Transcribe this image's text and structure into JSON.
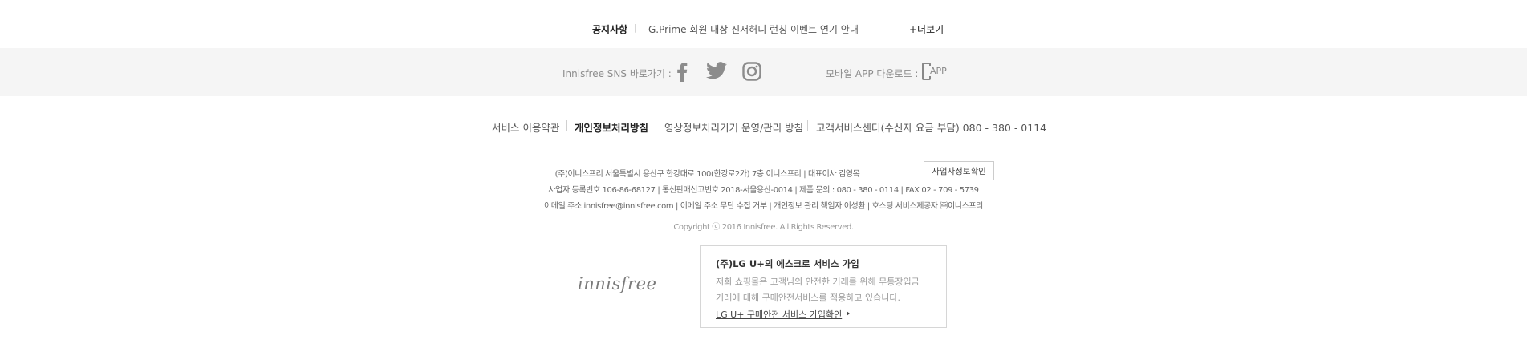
{
  "notice": {
    "title": "공지사항",
    "separator": "|",
    "text": "G.Prime 회원 대상 진저허니 런칭 이벤트 연기 안내",
    "more_label": "+더보기"
  },
  "sns": {
    "label": "Innisfree SNS 바로가기 :",
    "icons": [
      "facebook-icon",
      "twitter-icon",
      "instagram-icon"
    ],
    "app_label": "모바일 APP 다운로드 :",
    "app_icon_text": "APP"
  },
  "policy": {
    "terms": "서비스 이용약관",
    "privacy": "개인정보처리방침",
    "cctv": "영상정보처리기기 운영/관리 방침",
    "customer_center": "고객서비스센터(수신자 요금 부담) 080 - 380 - 0114"
  },
  "company": {
    "line1": "(주)이니스프리 서울특별시 용산구 한강대로 100(한강로2가) 7층 이니스프리 | 대표이사 김영목",
    "biz_button": "사업자정보확인",
    "line2": "사업자 등록번호 106-86-68127 | 통신판매신고번호 2018-서울용산-0014 | 제품 문의 : 080 - 380 - 0114 | FAX 02 - 709 - 5739",
    "line3": "이메일 주소 innisfree@innisfree.com | 이메일 주소 무단 수집 거부 | 개인정보 관리 책임자 이성환 | 호스팅 서비스제공자 ㈜이니스프리",
    "copyright": "Copyright ⓒ 2016 Innisfree. All Rights Reserved."
  },
  "logo": "innisfree",
  "escrow": {
    "title": "(주)LG U+의 에스크로 서비스 가입",
    "desc1": "저희 쇼핑몰은 고객님의 안전한 거래를 위해 무통장입금",
    "desc2": "거래에 대해 구매안전서비스를 적용하고 있습니다.",
    "link": "LG U+ 구매안전 서비스 가입확인"
  },
  "colors": {
    "sns_bar_bg": "#f5f5f5",
    "icon": "#8c8c8c"
  }
}
